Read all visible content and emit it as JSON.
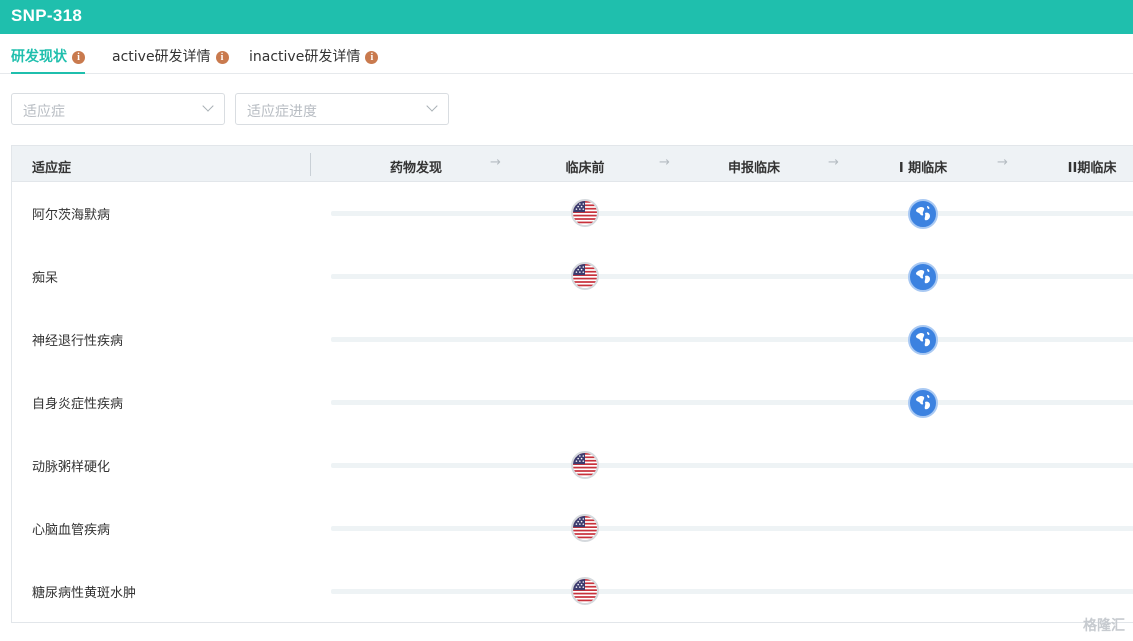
{
  "header": {
    "title": "SNP-318"
  },
  "tabs": [
    {
      "label": "研发现状",
      "active": true
    },
    {
      "label": "active研发详情",
      "active": false
    },
    {
      "label": "inactive研发详情",
      "active": false
    }
  ],
  "filters": {
    "indication_placeholder": "适应症",
    "progress_placeholder": "适应症进度"
  },
  "table": {
    "indication_header": "适应症",
    "phases": [
      "药物发现",
      "临床前",
      "申报临床",
      "I 期临床",
      "II期临床"
    ],
    "rows": [
      {
        "indication": "阿尔茨海默病",
        "markers": [
          {
            "phase": "临床前",
            "icon": "us-flag-icon"
          },
          {
            "phase": "I 期临床",
            "icon": "globe-icon"
          }
        ]
      },
      {
        "indication": "痴呆",
        "markers": [
          {
            "phase": "临床前",
            "icon": "us-flag-icon"
          },
          {
            "phase": "I 期临床",
            "icon": "globe-icon"
          }
        ]
      },
      {
        "indication": "神经退行性疾病",
        "markers": [
          {
            "phase": "I 期临床",
            "icon": "globe-icon"
          }
        ]
      },
      {
        "indication": "自身炎症性疾病",
        "markers": [
          {
            "phase": "I 期临床",
            "icon": "globe-icon"
          }
        ]
      },
      {
        "indication": "动脉粥样硬化",
        "markers": [
          {
            "phase": "临床前",
            "icon": "us-flag-icon"
          }
        ]
      },
      {
        "indication": "心脑血管疾病",
        "markers": [
          {
            "phase": "临床前",
            "icon": "us-flag-icon"
          }
        ]
      },
      {
        "indication": "糖尿病性黄斑水肿",
        "markers": [
          {
            "phase": "临床前",
            "icon": "us-flag-icon"
          }
        ]
      }
    ]
  },
  "watermark": "格隆汇",
  "colors": {
    "brand": "#1fbfad",
    "info_badge": "#c97a4e",
    "globe": "#3c82e0"
  }
}
